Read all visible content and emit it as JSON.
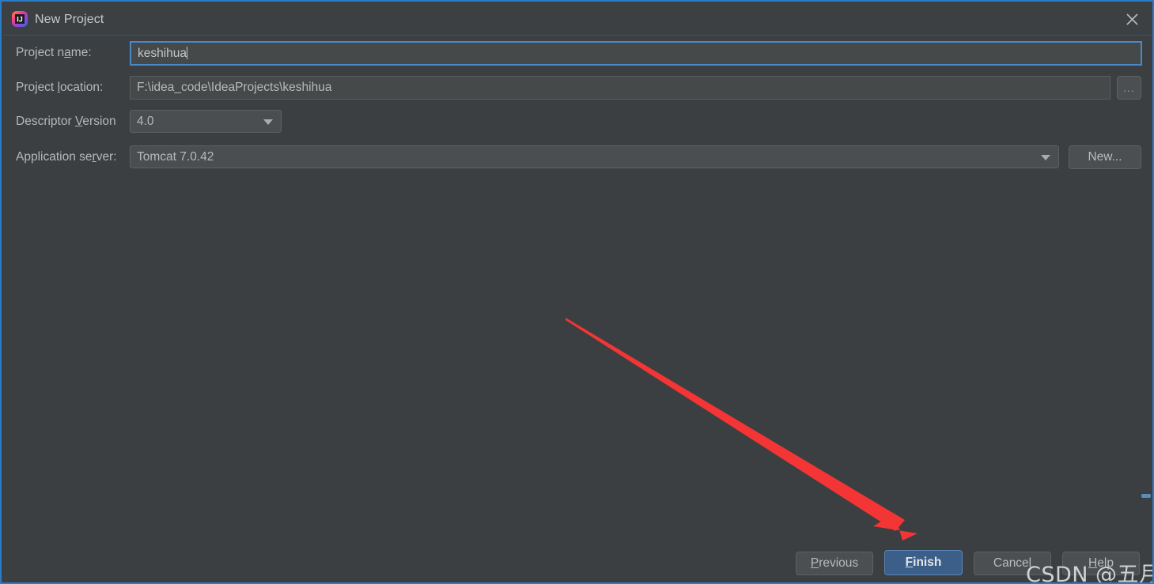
{
  "window": {
    "title": "New Project",
    "app_icon": "intellij-idea-icon",
    "close_icon": "close-icon",
    "border_color": "#2b7cc7",
    "background": "#3c3f41"
  },
  "form": {
    "fields": [
      {
        "key": "project_name",
        "label_prefix": "Project n",
        "label_mnemonic": "a",
        "label_suffix": "me:",
        "value": "keshihua",
        "type": "text",
        "focused": true
      },
      {
        "key": "project_location",
        "label_prefix": "Project ",
        "label_mnemonic": "l",
        "label_suffix": "ocation:",
        "value": "F:\\idea_code\\IdeaProjects\\keshihua",
        "type": "text",
        "focused": false
      },
      {
        "key": "descriptor_version",
        "label_prefix": "Descriptor ",
        "label_mnemonic": "V",
        "label_suffix": "ersion",
        "value": "4.0",
        "type": "combo"
      },
      {
        "key": "application_server",
        "label_prefix": "Application se",
        "label_mnemonic": "r",
        "label_suffix": "ver:",
        "value": "Tomcat 7.0.42",
        "type": "combo"
      }
    ],
    "browse_button_label": "...",
    "new_server_button_label": "New..."
  },
  "footer": {
    "previous": {
      "prefix": "",
      "mnemonic": "P",
      "suffix": "revious"
    },
    "finish": {
      "prefix": "",
      "mnemonic": "F",
      "suffix": "inish"
    },
    "cancel": {
      "prefix": "Cancel",
      "mnemonic": "",
      "suffix": ""
    },
    "help": {
      "prefix": "",
      "mnemonic": "H",
      "suffix": "elp"
    },
    "finish_color": "#3c5f8a"
  },
  "annotation": {
    "arrow_color": "#f43535",
    "arrow_start": "713,400",
    "arrow_end": "1158,673"
  },
  "watermark": {
    "text": "CSDN @五月CG"
  }
}
